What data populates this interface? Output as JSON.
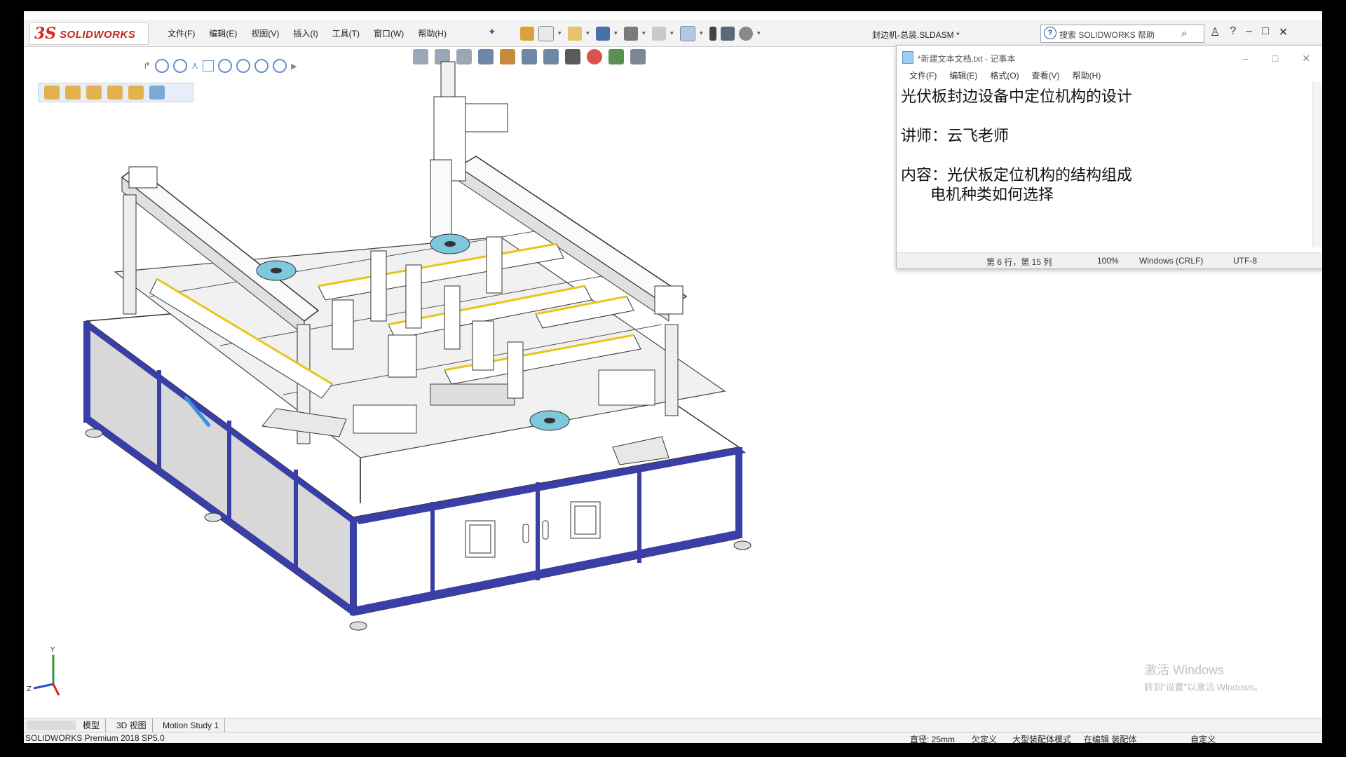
{
  "app": {
    "logo_ds": "3S",
    "logo_text": "SOLIDWORKS",
    "doc_title": "封边机-总装.SLDASM *"
  },
  "menu": [
    "文件(F)",
    "编辑(E)",
    "视图(V)",
    "插入(I)",
    "工具(T)",
    "窗口(W)",
    "帮助(H)"
  ],
  "search": {
    "placeholder": "搜索 SOLIDWORKS 帮助"
  },
  "notepad": {
    "title": "*新建文本文档.txt - 记事本",
    "menu": [
      "文件(F)",
      "编辑(E)",
      "格式(O)",
      "查看(V)",
      "帮助(H)"
    ],
    "lines": [
      "光伏板封边设备中定位机构的设计",
      "",
      "讲师：云飞老师",
      "",
      "内容：光伏板定位机构的结构组成",
      "      电机种类如何选择"
    ],
    "status": {
      "position": "第 6 行，第 15 列",
      "zoom": "100%",
      "line_ending": "Windows (CRLF)",
      "encoding": "UTF-8"
    }
  },
  "watermark": {
    "line1": "激活 Windows",
    "line2": "转到\"设置\"以激活 Windows。"
  },
  "tabs": [
    "模型",
    "3D 视图",
    "Motion Study 1"
  ],
  "statusbar": {
    "product": "SOLIDWORKS Premium 2018 SP5.0",
    "diameter": "直径: 25mm",
    "defined": "欠定义",
    "mode": "大型装配体模式",
    "editing": "在编辑 装配体",
    "custom": "自定义"
  },
  "colors": {
    "frame_blue": "#3a3fa8",
    "accent_red": "#c22222",
    "disc_cyan": "#7ec8dc",
    "belt_yellow": "#e6c619"
  }
}
